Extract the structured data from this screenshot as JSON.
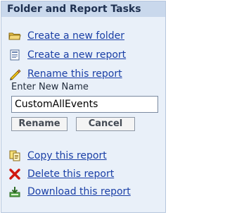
{
  "panel": {
    "title": "Folder and Report Tasks",
    "tasks": [
      {
        "label": "Create a new folder",
        "icon": "folder-icon"
      },
      {
        "label": "Create a new report",
        "icon": "report-icon"
      },
      {
        "label": "Rename this report",
        "icon": "pencil-icon"
      }
    ],
    "rename": {
      "label": "Enter New Name",
      "value": "CustomAllEvents",
      "rename_button": "Rename",
      "cancel_button": "Cancel"
    },
    "actions": [
      {
        "label": "Copy this report",
        "icon": "copy-icon"
      },
      {
        "label": "Delete this report",
        "icon": "delete-icon"
      },
      {
        "label": "Download this report",
        "icon": "download-icon"
      }
    ]
  }
}
